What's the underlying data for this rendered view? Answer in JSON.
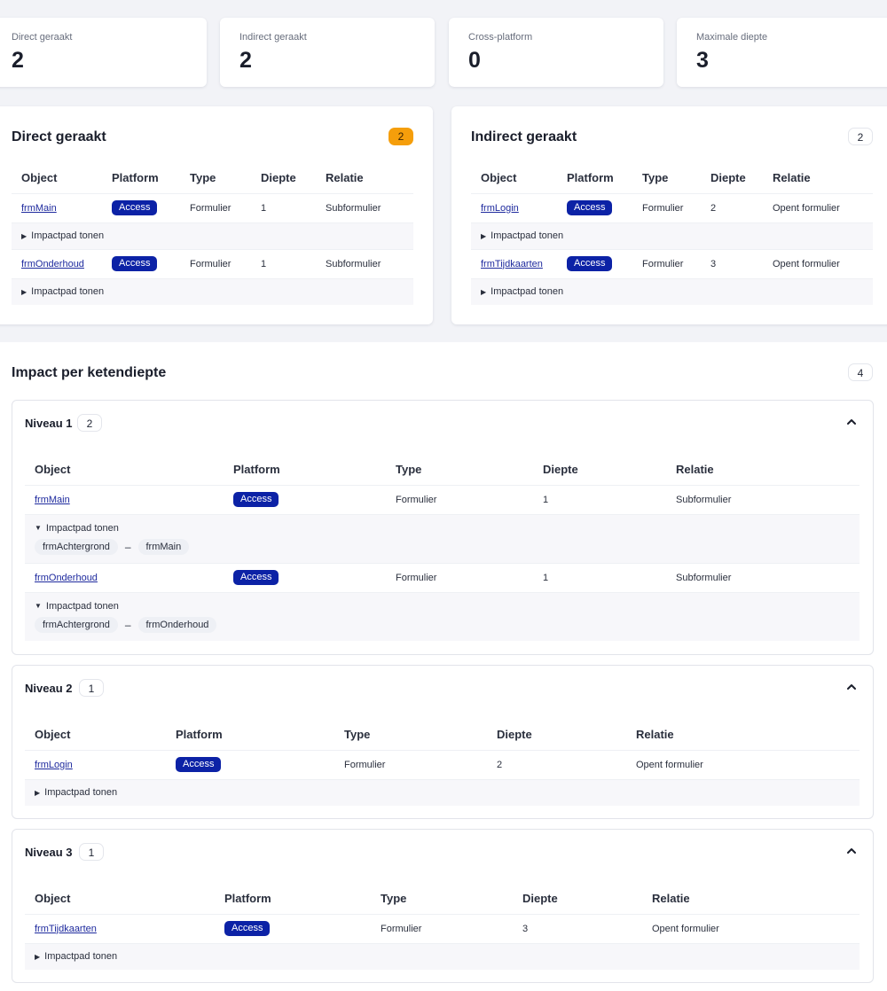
{
  "stats": [
    {
      "label": "Direct geraakt",
      "value": "2"
    },
    {
      "label": "Indirect geraakt",
      "value": "2"
    },
    {
      "label": "Cross-platform",
      "value": "0"
    },
    {
      "label": "Maximale diepte",
      "value": "3"
    }
  ],
  "direct": {
    "title": "Direct geraakt",
    "count": "2",
    "headers": [
      "Object",
      "Platform",
      "Type",
      "Diepte",
      "Relatie"
    ],
    "rows": [
      {
        "object": "frmMain",
        "platform": "Access",
        "type": "Formulier",
        "depth": "1",
        "relation": "Subformulier",
        "path_label": "Impactpad tonen"
      },
      {
        "object": "frmOnderhoud",
        "platform": "Access",
        "type": "Formulier",
        "depth": "1",
        "relation": "Subformulier",
        "path_label": "Impactpad tonen"
      }
    ]
  },
  "indirect": {
    "title": "Indirect geraakt",
    "count": "2",
    "headers": [
      "Object",
      "Platform",
      "Type",
      "Diepte",
      "Relatie"
    ],
    "rows": [
      {
        "object": "frmLogin",
        "platform": "Access",
        "type": "Formulier",
        "depth": "2",
        "relation": "Opent formulier",
        "path_label": "Impactpad tonen"
      },
      {
        "object": "frmTijdkaarten",
        "platform": "Access",
        "type": "Formulier",
        "depth": "3",
        "relation": "Opent formulier",
        "path_label": "Impactpad tonen"
      }
    ]
  },
  "impact": {
    "title": "Impact per ketendiepte",
    "count": "4",
    "headers": [
      "Object",
      "Platform",
      "Type",
      "Diepte",
      "Relatie"
    ],
    "levels": [
      {
        "title": "Niveau 1",
        "count": "2",
        "rows": [
          {
            "object": "frmMain",
            "platform": "Access",
            "type": "Formulier",
            "depth": "1",
            "relation": "Subformulier",
            "path_label": "Impactpad tonen",
            "path": [
              "frmAchtergrond",
              "frmMain"
            ],
            "separator": "–"
          },
          {
            "object": "frmOnderhoud",
            "platform": "Access",
            "type": "Formulier",
            "depth": "1",
            "relation": "Subformulier",
            "path_label": "Impactpad tonen",
            "path": [
              "frmAchtergrond",
              "frmOnderhoud"
            ],
            "separator": "–"
          }
        ]
      },
      {
        "title": "Niveau 2",
        "count": "1",
        "rows": [
          {
            "object": "frmLogin",
            "platform": "Access",
            "type": "Formulier",
            "depth": "2",
            "relation": "Opent formulier",
            "path_label": "Impactpad tonen"
          }
        ]
      },
      {
        "title": "Niveau 3",
        "count": "1",
        "rows": [
          {
            "object": "frmTijdkaarten",
            "platform": "Access",
            "type": "Formulier",
            "depth": "3",
            "relation": "Opent formulier",
            "path_label": "Impactpad tonen"
          }
        ]
      }
    ]
  },
  "icons": {
    "collapsed": "triangle-right-icon",
    "expanded": "triangle-down-icon",
    "level_toggle": "chevron-up-icon"
  },
  "colors": {
    "accent_badge": "#0c22a6",
    "warning_pill": "#f59e0b",
    "link": "#1e2a9e"
  }
}
